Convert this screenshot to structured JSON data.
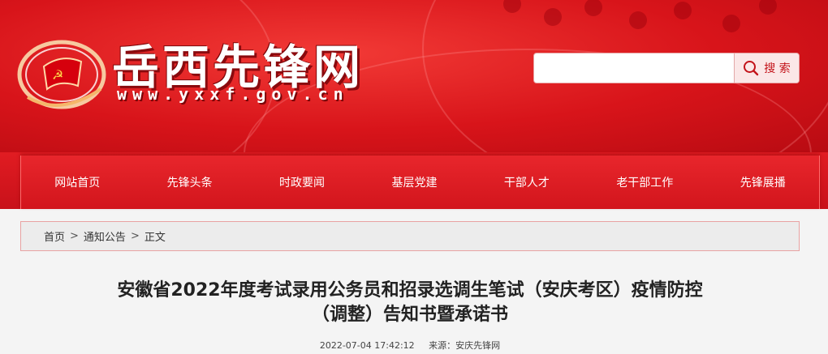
{
  "colors": {
    "brand_red": "#d8141a",
    "light_red": "#fbe7e7"
  },
  "header": {
    "site_title": "岳西先锋网",
    "site_url": "www.yxxf.gov.cn",
    "logo_icon": "party-flag-emblem-icon"
  },
  "search": {
    "value": "",
    "placeholder": "",
    "button_label": "搜 索",
    "button_icon": "search-icon"
  },
  "nav": {
    "items": [
      "网站首页",
      "先锋头条",
      "时政要闻",
      "基层党建",
      "干部人才",
      "老干部工作",
      "先锋展播"
    ]
  },
  "breadcrumb": {
    "home": "首页",
    "section": "通知公告",
    "current": "正文",
    "separator": ">"
  },
  "article": {
    "title_line1": "安徽省2022年度考试录用公务员和招录选调生笔试（安庆考区）疫情防控",
    "title_line2": "（调整）告知书暨承诺书",
    "date": "2022-07-04 17:42:12",
    "source": "来源：安庆先锋网"
  }
}
